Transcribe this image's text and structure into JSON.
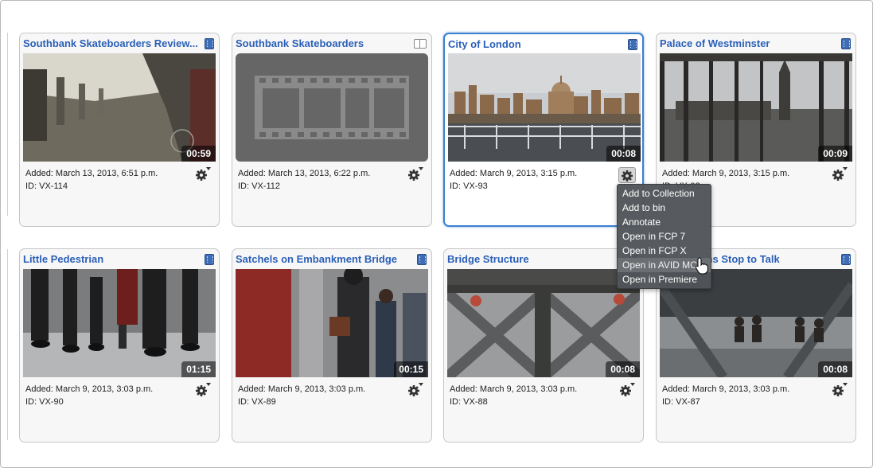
{
  "cards": [
    {
      "title": "Southbank Skateboarders Review....",
      "type": "video-icon",
      "duration": "00:59",
      "added": "Added: March 13, 2013, 6:51 p.m.",
      "id": "ID: VX-114"
    },
    {
      "title": "Southbank Skateboarders",
      "type": "sequence-icon",
      "duration": "",
      "added": "Added: March 13, 2013, 6:22 p.m.",
      "id": "ID: VX-112"
    },
    {
      "title": "City of London",
      "type": "video-icon",
      "duration": "00:08",
      "added": "Added: March 9, 2013, 3:15 p.m.",
      "id": "ID: VX-93"
    },
    {
      "title": "Palace of Westminster",
      "type": "video-icon",
      "duration": "00:09",
      "added": "Added: March 9, 2013, 3:15 p.m.",
      "id": "ID: VX-92"
    },
    {
      "title": "Little Pedestrian",
      "type": "video-icon",
      "duration": "01:15",
      "added": "Added: March 9, 2013, 3:03 p.m.",
      "id": "ID: VX-90"
    },
    {
      "title": "Satchels on Embankment Bridge",
      "type": "video-icon",
      "duration": "00:15",
      "added": "Added: March 9, 2013, 3:03 p.m.",
      "id": "ID: VX-89"
    },
    {
      "title": "Bridge Structure",
      "type": "video-icon",
      "duration": "00:08",
      "added": "Added: March 9, 2013, 3:03 p.m.",
      "id": "ID: VX-88"
    },
    {
      "title": "Pedestrians Stop to Talk",
      "type": "video-icon",
      "duration": "00:08",
      "added": "Added: March 9, 2013, 3:03 p.m.",
      "id": "ID: VX-87"
    }
  ],
  "context_menu": {
    "items": [
      "Add to Collection",
      "Add to bin",
      "Annotate",
      "Open in FCP 7",
      "Open in FCP X",
      "Open in AVID MC",
      "Open in Premiere"
    ],
    "hovered": "Open in AVID MC"
  },
  "colors": {
    "title_link": "#2b5fb8",
    "selection_border": "#3b7fd1",
    "menu_background": "#505458"
  }
}
